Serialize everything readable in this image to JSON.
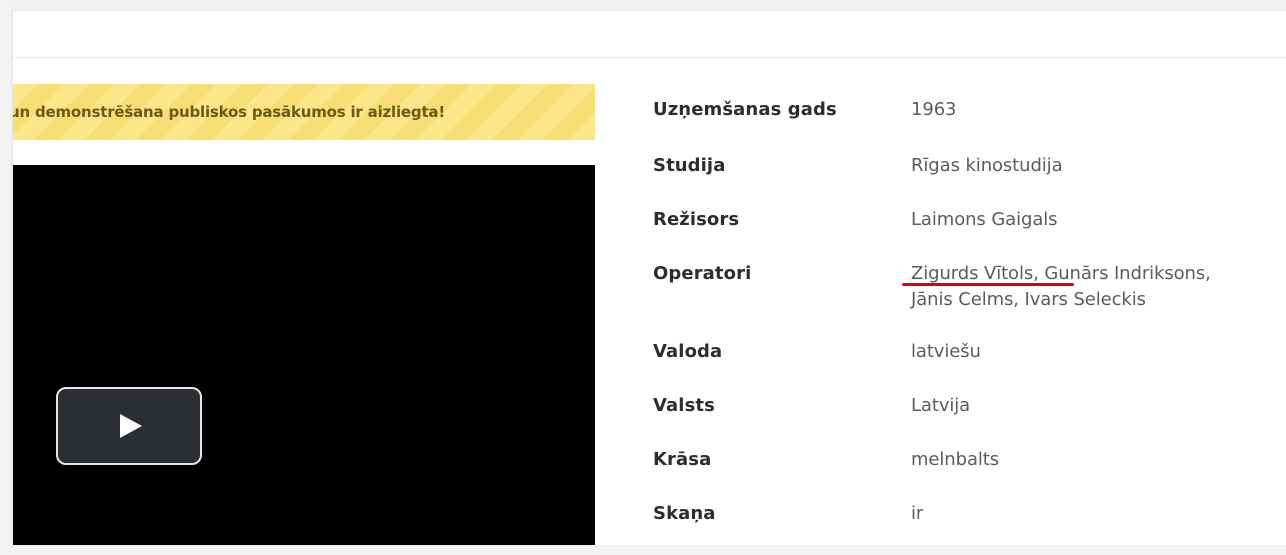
{
  "banner": {
    "warning_text": "un demonstrēšana publiskos pasākumos ir aizliegta!"
  },
  "video": {
    "play_label": "Play"
  },
  "details": [
    {
      "label": "Uzņemšanas gads",
      "value": "1963"
    },
    {
      "label": "Studija",
      "value": "Rīgas kinostudija"
    },
    {
      "label": "Režisors",
      "value": "Laimons Gaigals"
    },
    {
      "label": "Operatori",
      "value_line1": "Zigurds Vītols, Gunārs Indriksons,",
      "value_line2": "Jānis Celms, Ivars Seleckis"
    },
    {
      "label": "Valoda",
      "value": "latviešu"
    },
    {
      "label": "Valsts",
      "value": "Latvija"
    },
    {
      "label": "Krāsa",
      "value": "melnbalts"
    },
    {
      "label": "Skaņa",
      "value": "ir"
    }
  ],
  "colors": {
    "warning_bg": "#fbe68a",
    "warning_text": "#6b5a12",
    "video_bg": "#000000",
    "label": "#2d2d2f",
    "value": "#5c5c60",
    "underline_mark": "#e10000"
  },
  "icons": {
    "play": "play-icon"
  }
}
